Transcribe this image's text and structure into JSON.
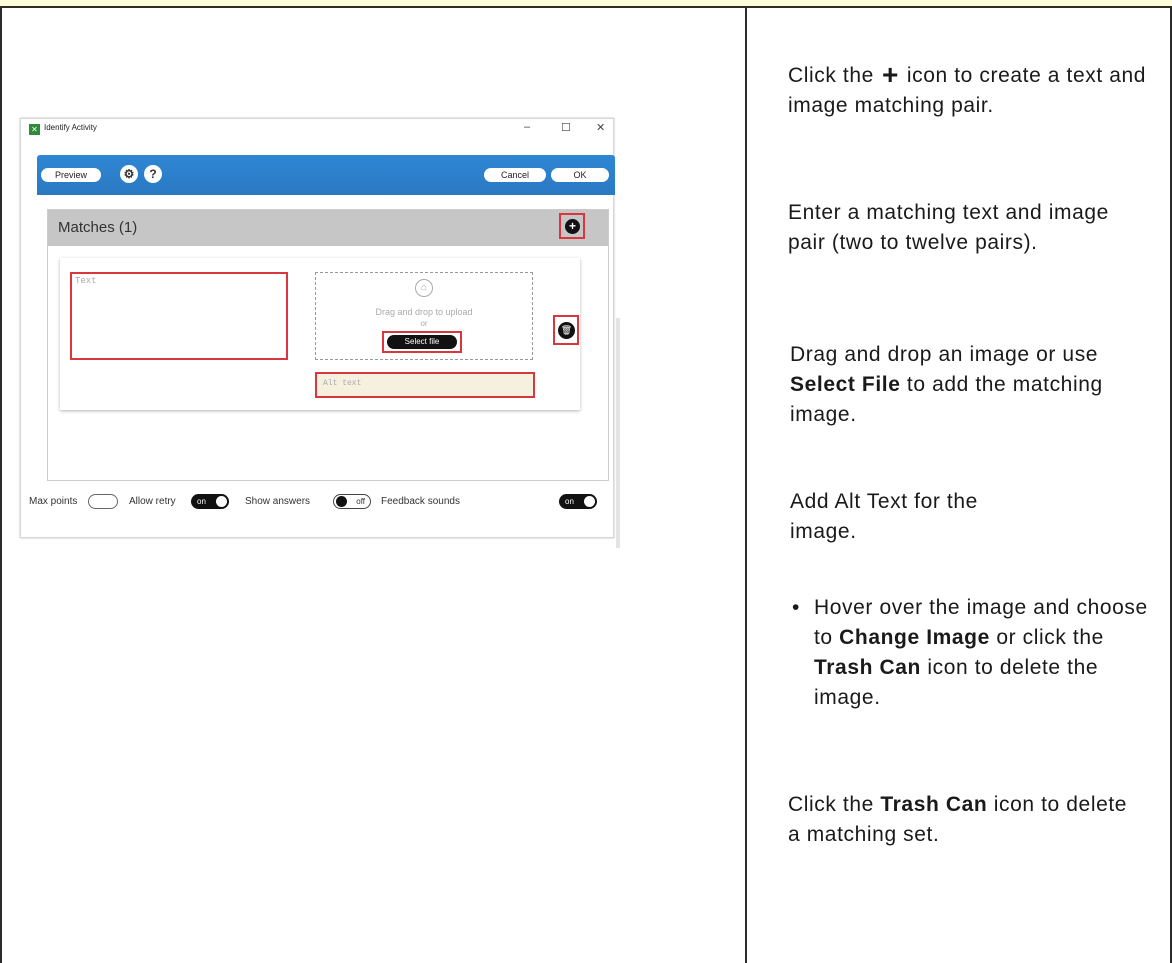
{
  "screenshot": {
    "window_title": "Identify Activity",
    "window_controls": [
      "–",
      "☐",
      "✕"
    ],
    "toolbar": {
      "preview_label": "Preview",
      "settings_icon": "gear-icon",
      "help_label": "?",
      "cancel_label": "Cancel",
      "ok_label": "OK"
    },
    "panel": {
      "title": "Matches (1)",
      "add_icon": "+",
      "text_placeholder": "Text",
      "drop_text": "Drag and drop to upload",
      "drop_or": "or",
      "select_file_label": "Select file",
      "alt_text_placeholder": "Alt text",
      "trash_icon": "trash-icon"
    },
    "footer": {
      "max_points_label": "Max points",
      "allow_retry_label": "Allow retry",
      "allow_retry_value": "on",
      "show_answers_label": "Show answers",
      "show_answers_value": "off",
      "feedback_sounds_label": "Feedback sounds",
      "feedback_sounds_value": "on"
    }
  },
  "instructions": {
    "step1_a": "Click the",
    "step1_icon": "+",
    "step1_b": "icon to create a text and image matching pair.",
    "step2": "Enter a matching text and image pair (two to twelve pairs).",
    "step3_a": "Drag and drop an image or use",
    "step3_bold": "Select File",
    "step3_b": "to add the matching image.",
    "step4": "Add Alt Text for the image.",
    "step5_a": "Hover over the image and choose to",
    "step5_bold1": "Change Image",
    "step5_b": "or click the",
    "step5_bold2": "Trash Can",
    "step5_c": "icon to delete the image.",
    "step6_a": "Click the",
    "step6_bold": "Trash Can",
    "step6_b": "icon to delete a matching set."
  }
}
